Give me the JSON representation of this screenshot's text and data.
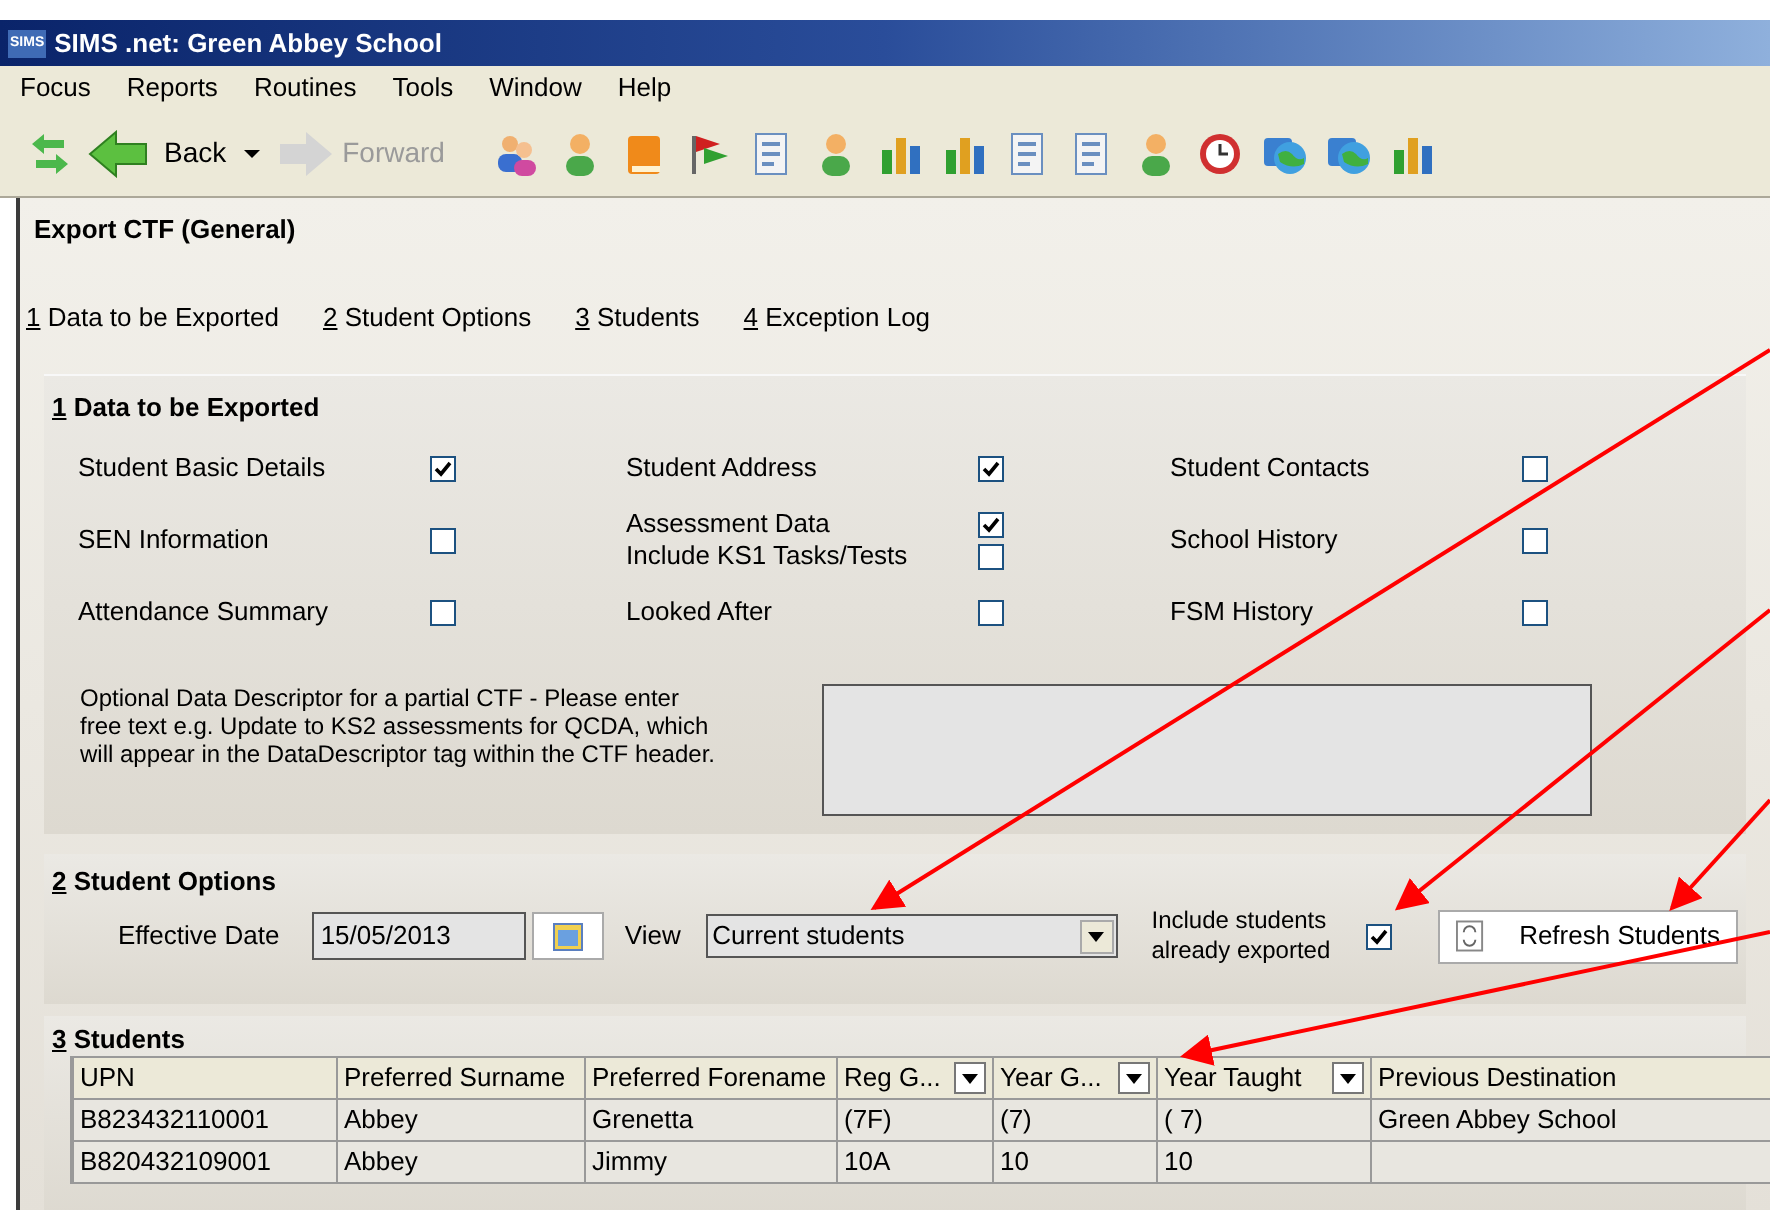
{
  "window": {
    "title": "SIMS .net: Green Abbey School",
    "logo": "SIMS"
  },
  "menu": [
    "Focus",
    "Reports",
    "Routines",
    "Tools",
    "Window",
    "Help"
  ],
  "toolbar": {
    "back": "Back",
    "forward": "Forward",
    "forward_disabled": true,
    "icons": [
      {
        "kind": "people"
      },
      {
        "kind": "person"
      },
      {
        "kind": "book"
      },
      {
        "kind": "flag"
      },
      {
        "kind": "document"
      },
      {
        "kind": "person"
      },
      {
        "kind": "chart"
      },
      {
        "kind": "chart"
      },
      {
        "kind": "document"
      },
      {
        "kind": "document"
      },
      {
        "kind": "person"
      },
      {
        "kind": "clock"
      },
      {
        "kind": "globe"
      },
      {
        "kind": "globe"
      },
      {
        "kind": "chart"
      }
    ]
  },
  "page": {
    "title": "Export CTF (General)",
    "links": [
      {
        "number": "1",
        "label": "Data to be Exported"
      },
      {
        "number": "2",
        "label": "Student Options"
      },
      {
        "number": "3",
        "label": "Students"
      },
      {
        "number": "4",
        "label": "Exception Log"
      }
    ]
  },
  "data_section": {
    "number": "1",
    "title": "Data to be Exported",
    "cells": [
      {
        "options": [
          {
            "label": "Student Basic Details",
            "checked": true
          }
        ]
      },
      {
        "options": [
          {
            "label": "Student Address",
            "checked": true
          }
        ]
      },
      {
        "options": [
          {
            "label": "Student Contacts",
            "checked": false
          }
        ]
      },
      {
        "options": [
          {
            "label": "SEN Information",
            "checked": false
          }
        ]
      },
      {
        "options": [
          {
            "label": "Assessment Data",
            "checked": true
          },
          {
            "label": "Include KS1 Tasks/Tests",
            "checked": false
          }
        ]
      },
      {
        "options": [
          {
            "label": "School History",
            "checked": false
          }
        ]
      },
      {
        "options": [
          {
            "label": "Attendance Summary",
            "checked": false
          }
        ]
      },
      {
        "options": [
          {
            "label": "Looked After",
            "checked": false
          }
        ]
      },
      {
        "options": [
          {
            "label": "FSM History",
            "checked": false
          }
        ]
      }
    ],
    "descriptor_label": "Optional Data Descriptor for a partial CTF - Please enter free text e.g. Update to KS2 assessments for QCDA, which will appear in the DataDescriptor tag within the CTF header."
  },
  "options_section": {
    "number": "2",
    "title": "Student Options",
    "date_label": "Effective Date",
    "date": "15/05/2013",
    "view_label": "View",
    "view": "Current students",
    "include_label": "Include students already exported",
    "include_checked": true,
    "refresh": "Refresh Students"
  },
  "students": {
    "number": "3",
    "title": "Students",
    "columns": [
      {
        "label": "UPN",
        "filter": false
      },
      {
        "label": "Preferred Surname",
        "filter": false
      },
      {
        "label": "Preferred Forename",
        "filter": false
      },
      {
        "label": "Reg G...",
        "filter": true
      },
      {
        "label": "Year G...",
        "filter": true
      },
      {
        "label": "Year Taught",
        "filter": true
      },
      {
        "label": "Previous Destination",
        "filter": false
      }
    ],
    "rows": [
      [
        "B823432110001",
        "Abbey",
        "Grenetta",
        "(7F)",
        "(7)",
        "( 7)",
        "Green Abbey School"
      ],
      [
        "B820432109001",
        "Abbey",
        "Jimmy",
        "10A",
        "10",
        "10",
        ""
      ]
    ]
  }
}
